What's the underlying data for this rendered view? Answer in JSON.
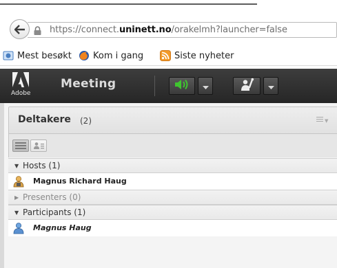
{
  "browser": {
    "url": {
      "prefix": "https://connect.",
      "domain": "uninett.no",
      "path": "/orakelmh?launcher=false"
    },
    "bookmarks": [
      {
        "label": "Mest besøkt",
        "icon": "most-visited-icon"
      },
      {
        "label": "Kom i gang",
        "icon": "firefox-icon"
      },
      {
        "label": "Siste nyheter",
        "icon": "rss-feed-icon"
      }
    ]
  },
  "app": {
    "logo_text": "Adobe",
    "menu_meeting": "Meeting",
    "accent_audio": "#39c02b"
  },
  "attendees": {
    "title": "Deltakere",
    "count": "(2)",
    "sections": [
      {
        "label": "Hosts (1)",
        "expanded": true,
        "muted": false
      },
      {
        "label": "Presenters (0)",
        "expanded": false,
        "muted": true
      },
      {
        "label": "Participants (1)",
        "expanded": true,
        "muted": false
      }
    ],
    "people": [
      {
        "name": "Magnus Richard Haug",
        "role": "host"
      },
      {
        "name": "Magnus Haug",
        "role": "participant"
      }
    ]
  }
}
